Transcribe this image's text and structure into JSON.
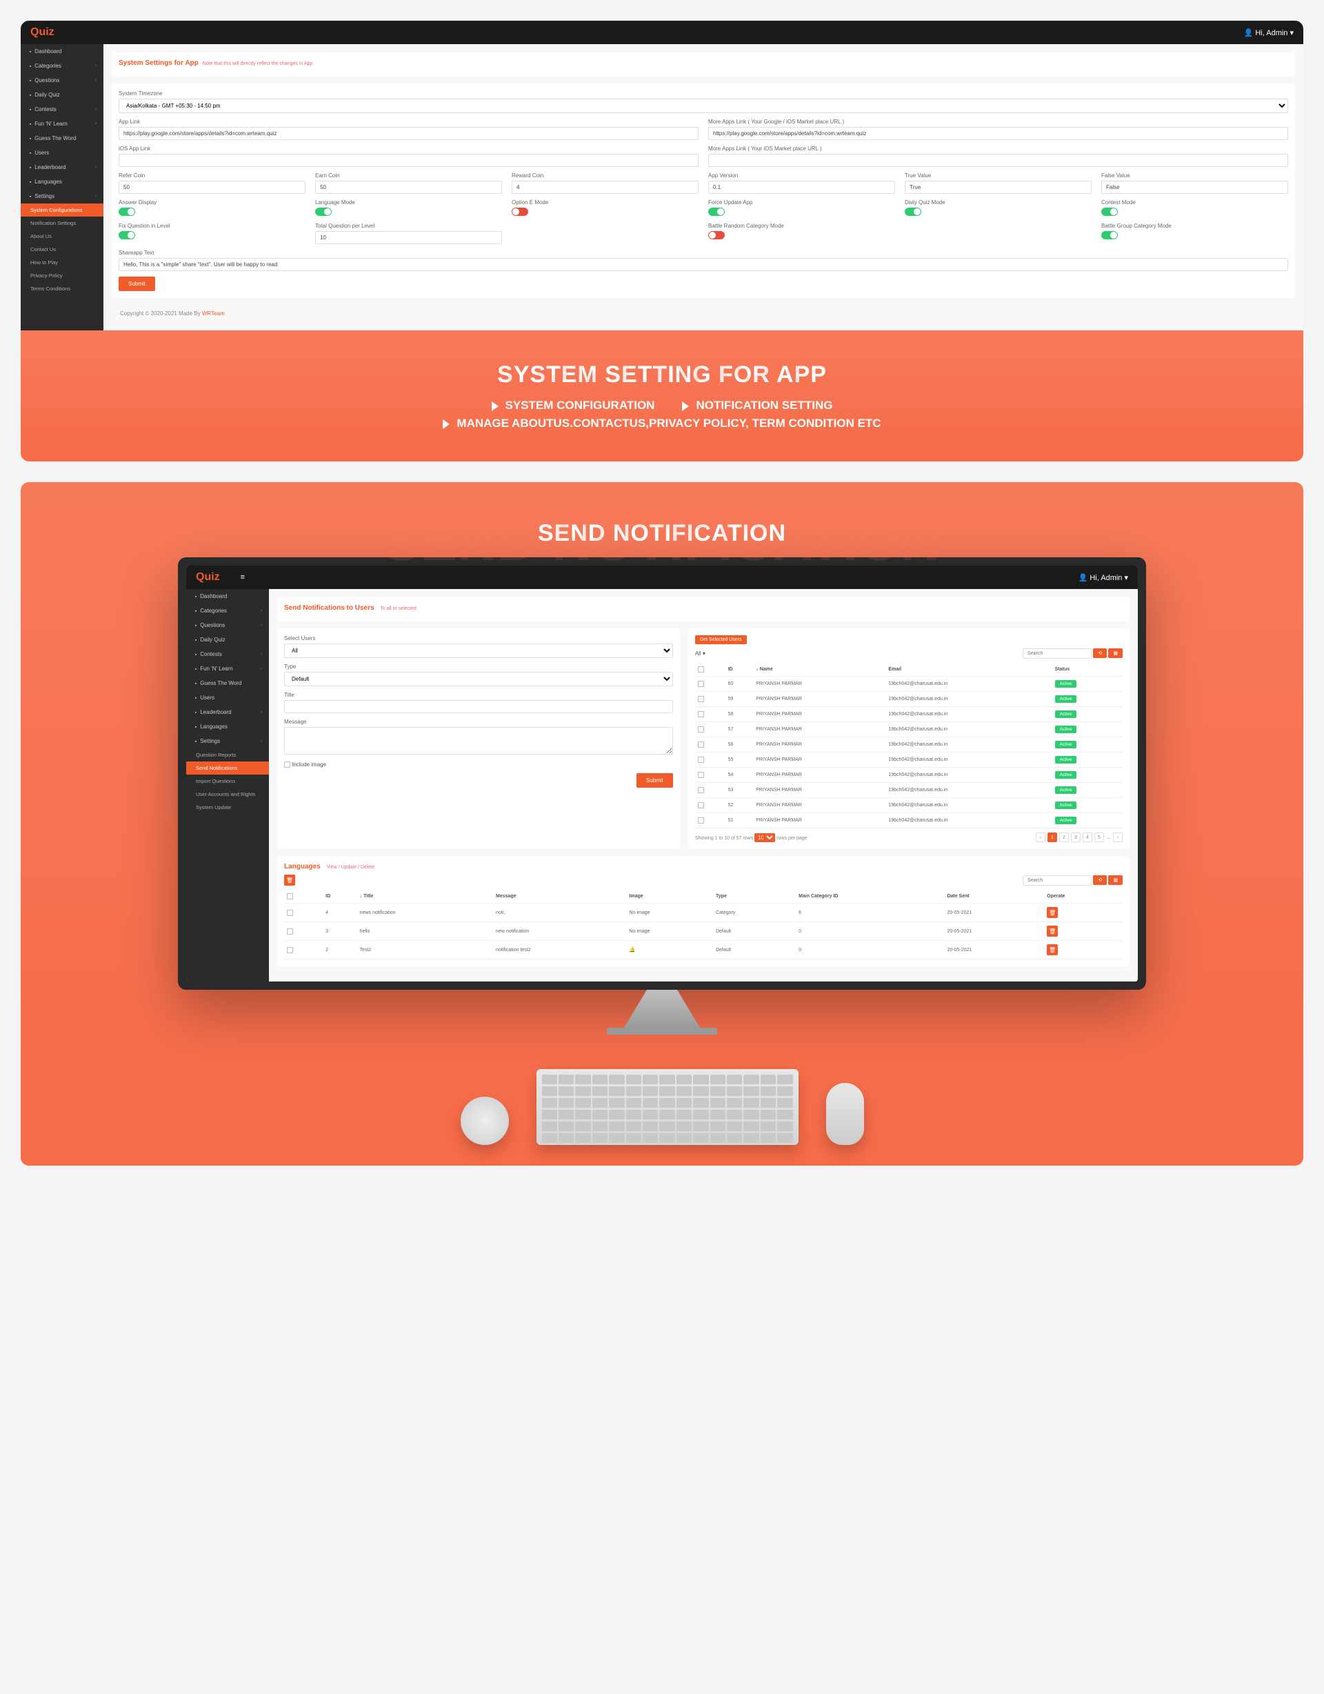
{
  "header": {
    "greeting": "Hi, Admin",
    "logo": "Quiz"
  },
  "sidebar": {
    "items": [
      {
        "label": "Dashboard"
      },
      {
        "label": "Categories",
        "chev": true
      },
      {
        "label": "Questions",
        "chev": true
      },
      {
        "label": "Daily Quiz"
      },
      {
        "label": "Contests",
        "chev": true
      },
      {
        "label": "Fun 'N' Learn",
        "chev": true
      },
      {
        "label": "Guess The Word"
      },
      {
        "label": "Users"
      },
      {
        "label": "Leaderboard",
        "chev": true
      },
      {
        "label": "Languages"
      },
      {
        "label": "Settings",
        "chev": true
      }
    ],
    "subs": [
      {
        "label": "System Configurations",
        "active": true
      },
      {
        "label": "Notification Settings"
      },
      {
        "label": "About Us"
      },
      {
        "label": "Contact Us"
      },
      {
        "label": "How to Play"
      },
      {
        "label": "Privacy Policy"
      },
      {
        "label": "Terms Conditions"
      }
    ],
    "subs2": [
      {
        "label": "Question Reports"
      },
      {
        "label": "Send Notifications",
        "active": true
      },
      {
        "label": "Import Questions"
      },
      {
        "label": "User Accounts and Rights"
      },
      {
        "label": "System Update"
      }
    ]
  },
  "settings": {
    "title": "System Settings for App",
    "note": "Note that this will directly reflect the changes in App",
    "timezone_label": "System Timezone",
    "timezone_value": "Asia/Kolkata - GMT +05:30 - 14:50 pm",
    "app_link_label": "App Link",
    "app_link_value": "https://play.google.com/store/apps/details?id=com.wrteam.quiz",
    "more_apps_label": "More Apps Link ( Your Google / iOS Market place URL )",
    "more_apps_value": "https://play.google.com/store/apps/details?id=com.wrteam.quiz",
    "ios_link_label": "iOS App Link",
    "more_ios_label": "More Apps Link ( Your iOS Market place URL )",
    "refer_label": "Refer Coin",
    "refer_value": "50",
    "earn_label": "Earn Coin",
    "earn_value": "50",
    "reward_label": "Reward Coin",
    "reward_value": "4",
    "version_label": "App Version",
    "version_value": "0.1",
    "true_label": "True Value",
    "true_value": "True",
    "false_label": "False Value",
    "false_value": "False",
    "answer_disp": "Answer Display",
    "lang_mode": "Language Mode",
    "optE": "Option E Mode",
    "force": "Force Update App",
    "dailyq": "Daily Quiz Mode",
    "contest": "Contest Mode",
    "fixq": "Fix Question in Level",
    "totalq_label": "Total Question per Level",
    "totalq_value": "10",
    "battle_rand": "Battle Random Category Mode",
    "battle_group": "Battle Group Category Mode",
    "share_label": "Shareapp Text",
    "share_value": "Hello, This is a \"simple\" share \"text\". User will be happy to read",
    "submit": "Submit"
  },
  "footer": {
    "text": "Copyright © 2020-2021 Made By ",
    "brand": "WRTeam"
  },
  "section1": {
    "ghost": "SYSTEM SETTING FOR APP",
    "title": "SYSTEM SETTING FOR APP",
    "b1": "SYSTEM CONFIGURATION",
    "b2": "NOTIFICATION SETTING",
    "b3": "MANAGE ABOUTUS.CONTACTUS,PRIVACY POLICY, TERM CONDITION ETC"
  },
  "section2": {
    "ghost": "SEND NOTIFICATION",
    "title": "SEND NOTIFICATION"
  },
  "notify": {
    "title": "Send Notifications to Users",
    "sub": "To all or selected",
    "sel_users_label": "Select Users",
    "sel_users_value": "All",
    "type_label": "Type",
    "type_value": "Default",
    "title_label": "Title",
    "msg_label": "Message",
    "include_img": "Include image",
    "submit": "Submit",
    "get_selected": "Get Selected Users",
    "all": "All",
    "search": "Search",
    "cols": {
      "id": "ID",
      "name": "Name",
      "email": "Email",
      "status": "Status"
    },
    "rows": [
      {
        "id": "60",
        "name": "PRIYANSH PARMAR",
        "email": "19bch042@charusat.edu.in",
        "status": "Active"
      },
      {
        "id": "59",
        "name": "PRIYANSH PARMAR",
        "email": "19bch042@charusat.edu.in",
        "status": "Active"
      },
      {
        "id": "58",
        "name": "PRIYANSH PARMAR",
        "email": "19bch042@charusat.edu.in",
        "status": "Active"
      },
      {
        "id": "57",
        "name": "PRIYANSH PARMAR",
        "email": "19bch042@charusat.edu.in",
        "status": "Active"
      },
      {
        "id": "56",
        "name": "PRIYANSH PARMAR",
        "email": "19bch042@charusat.edu.in",
        "status": "Active"
      },
      {
        "id": "55",
        "name": "PRIYANSH PARMAR",
        "email": "19bch042@charusat.edu.in",
        "status": "Active"
      },
      {
        "id": "54",
        "name": "PRIYANSH PARMAR",
        "email": "19bch042@charusat.edu.in",
        "status": "Active"
      },
      {
        "id": "53",
        "name": "PRIYANSH PARMAR",
        "email": "19bch042@charusat.edu.in",
        "status": "Active"
      },
      {
        "id": "52",
        "name": "PRIYANSH PARMAR",
        "email": "19bch042@charusat.edu.in",
        "status": "Active"
      },
      {
        "id": "51",
        "name": "PRIYANSH PARMAR",
        "email": "19bch042@charusat.edu.in",
        "status": "Active"
      }
    ],
    "paging_text": "Showing 1 to 10 of 57 rows",
    "per_page": "10",
    "per_page_suffix": "rows per page"
  },
  "lang": {
    "title": "Languages",
    "sub": "View / Update / Delete",
    "search": "Search",
    "cols": {
      "id": "ID",
      "title": "Title",
      "msg": "Message",
      "img": "Image",
      "type": "Type",
      "cat": "Main Category ID",
      "date": "Date Sent",
      "op": "Operate"
    },
    "rows": [
      {
        "id": "4",
        "title": "news notification",
        "msg": "noti.",
        "img": "No image",
        "type": "Category",
        "cat": "6",
        "date": "20-05-2021"
      },
      {
        "id": "3",
        "title": "hello",
        "msg": "new notification",
        "img": "No image",
        "type": "Default",
        "cat": "0",
        "date": "20-05-2021"
      },
      {
        "id": "2",
        "title": "Test2",
        "msg": "notification test2",
        "img": "🔔",
        "type": "Default",
        "cat": "0",
        "date": "20-05-2021"
      }
    ]
  }
}
